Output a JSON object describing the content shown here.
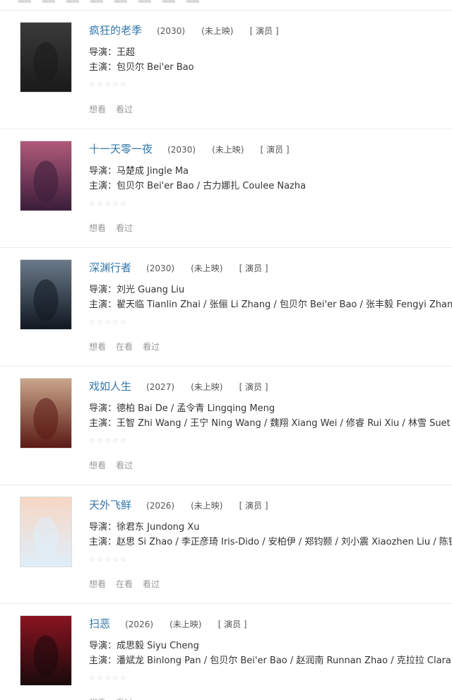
{
  "labels": {
    "director": "导演：",
    "cast": "主演："
  },
  "star_icon": "☆",
  "colors": {
    "title_link": "#3377aa",
    "muted": "#999999",
    "divider": "#ececec"
  },
  "movies": [
    {
      "title": "疯狂的老季",
      "year": "(2030)",
      "status": "(未上映)",
      "role": "[ 演员 ]",
      "director": "王超",
      "cast": "包贝尔 Bei'er Bao",
      "actions": [
        "想看",
        "看过"
      ],
      "poster_colors": [
        "#1a1a1a",
        "#3a3a3a"
      ]
    },
    {
      "title": "十一天零一夜",
      "year": "(2030)",
      "status": "(未上映)",
      "role": "[ 演员 ]",
      "director": "马楚成 Jingle Ma",
      "cast": "包贝尔 Bei'er Bao / 古力娜扎 Coulee Nazha",
      "actions": [
        "想看",
        "看过"
      ],
      "poster_colors": [
        "#3b1d3a",
        "#b05a7a"
      ]
    },
    {
      "title": "深渊行者",
      "year": "(2030)",
      "status": "(未上映)",
      "role": "[ 演员 ]",
      "director": "刘光 Guang Liu",
      "cast": "翟天临 Tianlin Zhai / 张俪 Li Zhang / 包贝尔 Bei'er Bao / 张丰毅 Fengyi Zhang / 张嘉",
      "actions": [
        "想看",
        "在看",
        "看过"
      ],
      "poster_colors": [
        "#101820",
        "#6a7a8a"
      ]
    },
    {
      "title": "戏如人生",
      "year": "(2027)",
      "status": "(未上映)",
      "role": "[ 演员 ]",
      "director": "德柏 Bai De / 孟令青 Lingqing Meng",
      "cast": "王智 Zhi Wang / 王宁 Ning Wang / 魏翔 Xiang Wei / 修睿 Rui Xiu / 林雪 Suet Lam / 倪",
      "actions": [
        "想看",
        "看过"
      ],
      "poster_colors": [
        "#5a1a14",
        "#c9a58a"
      ]
    },
    {
      "title": "天外飞鲜",
      "year": "(2026)",
      "status": "(未上映)",
      "role": "[ 演员 ]",
      "director": "徐君东 Jundong Xu",
      "cast": "赵思 Si Zhao / 李正彦琦 Iris-Dido / 安柏伊 / 郑钧颢 / 刘小震 Xiaozhen Liu / 陈铮 Zhen",
      "actions": [
        "想看",
        "在看",
        "看过"
      ],
      "poster_colors": [
        "#dfeefa",
        "#f7d6c4"
      ]
    },
    {
      "title": "扫恶",
      "year": "(2026)",
      "status": "(未上映)",
      "role": "[ 演员 ]",
      "director": "成思毅 Siyu Cheng",
      "cast": "潘斌龙 Binlong Pan / 包贝尔 Bei'er Bao / 赵润南 Runnan Zhao / 克拉拉 Clara Lee",
      "actions": [
        "想看",
        "看过"
      ],
      "poster_colors": [
        "#1a0a0c",
        "#8a1420"
      ]
    }
  ]
}
